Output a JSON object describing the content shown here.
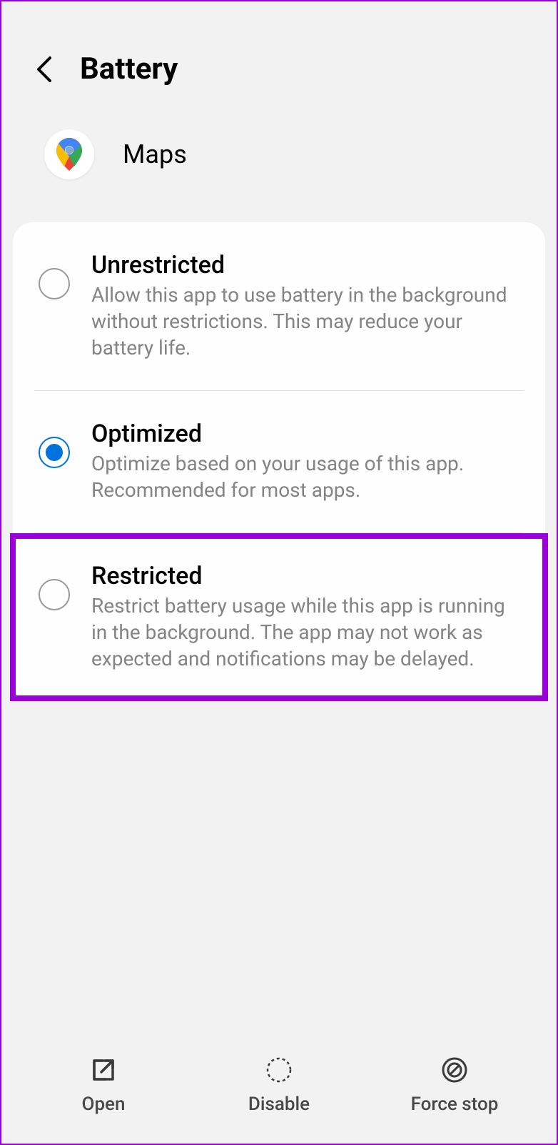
{
  "header": {
    "title": "Battery"
  },
  "app": {
    "name": "Maps"
  },
  "options": [
    {
      "title": "Unrestricted",
      "description": "Allow this app to use battery in the background without restrictions. This may reduce your battery life.",
      "selected": false,
      "highlighted": false
    },
    {
      "title": "Optimized",
      "description": "Optimize based on your usage of this app. Recommended for most apps.",
      "selected": true,
      "highlighted": false
    },
    {
      "title": "Restricted",
      "description": "Restrict battery usage while this app is running in the background. The app may not work as expected and notifications may be delayed.",
      "selected": false,
      "highlighted": true
    }
  ],
  "bottomBar": {
    "open": "Open",
    "disable": "Disable",
    "forceStop": "Force stop"
  }
}
